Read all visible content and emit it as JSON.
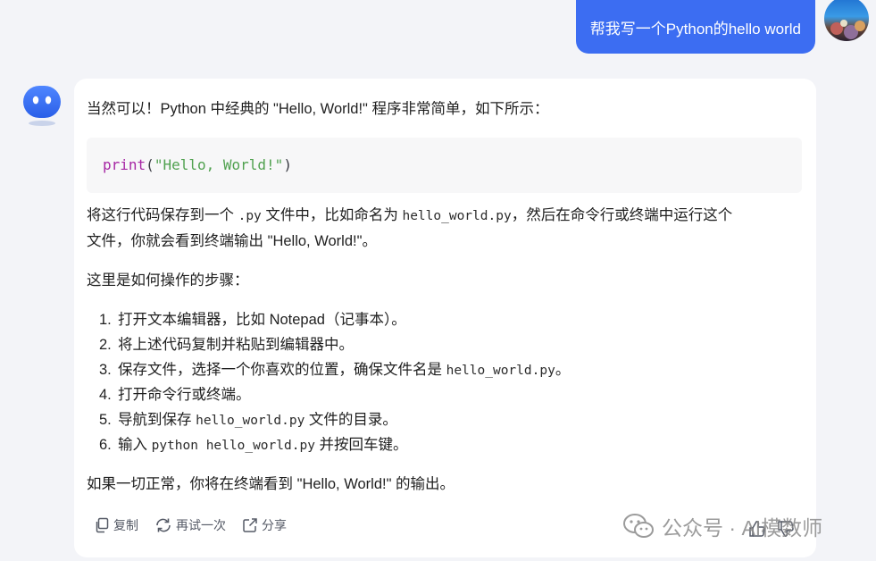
{
  "user_message": {
    "text": "帮我写一个Python的hello world",
    "bubble_color": "#3c6df2"
  },
  "bot_message": {
    "intro": "当然可以！Python 中经典的 \"Hello, World!\" 程序非常简单，如下所示：",
    "code": {
      "fn": "print",
      "open": "(",
      "str": "\"Hello, World!\"",
      "close": ")"
    },
    "save": {
      "line1_a": "将这行代码保存到一个 ",
      "line1_code1": ".py",
      "line1_b": " 文件中，比如命名为 ",
      "line1_code2": "hello_world.py",
      "line1_c": "，然后在命令行或终端中运行这个",
      "line2": "文件，你就会看到终端输出 \"Hello, World!\"。"
    },
    "steps_title": "这里是如何操作的步骤：",
    "steps": [
      {
        "num": "1.",
        "a": "打开文本编辑器，比如 Notepad（记事本）。"
      },
      {
        "num": "2.",
        "a": "将上述代码复制并粘贴到编辑器中。"
      },
      {
        "num": "3.",
        "a": "保存文件，选择一个你喜欢的位置，确保文件名是 ",
        "code": "hello_world.py",
        "b": "。"
      },
      {
        "num": "4.",
        "a": "打开命令行或终端。"
      },
      {
        "num": "5.",
        "a": "导航到保存 ",
        "code": "hello_world.py",
        "b": " 文件的目录。"
      },
      {
        "num": "6.",
        "a": "输入 ",
        "code": "python hello_world.py",
        "b": " 并按回车键。"
      }
    ],
    "final": "如果一切正常，你将在终端看到 \"Hello, World!\" 的输出。"
  },
  "actions": {
    "copy_label": "复制",
    "retry_label": "再试一次",
    "share_label": "分享",
    "icons": [
      "copy-icon",
      "refresh-icon",
      "share-icon",
      "thumbs-up-icon",
      "thumbs-down-icon"
    ]
  },
  "watermark": {
    "text": "公众号 · AI模数师"
  },
  "colors": {
    "background": "#f3f4f8",
    "card": "#ffffff",
    "accent": "#3c6df2",
    "code_fn": "#a626a4",
    "code_str": "#50a14f"
  }
}
